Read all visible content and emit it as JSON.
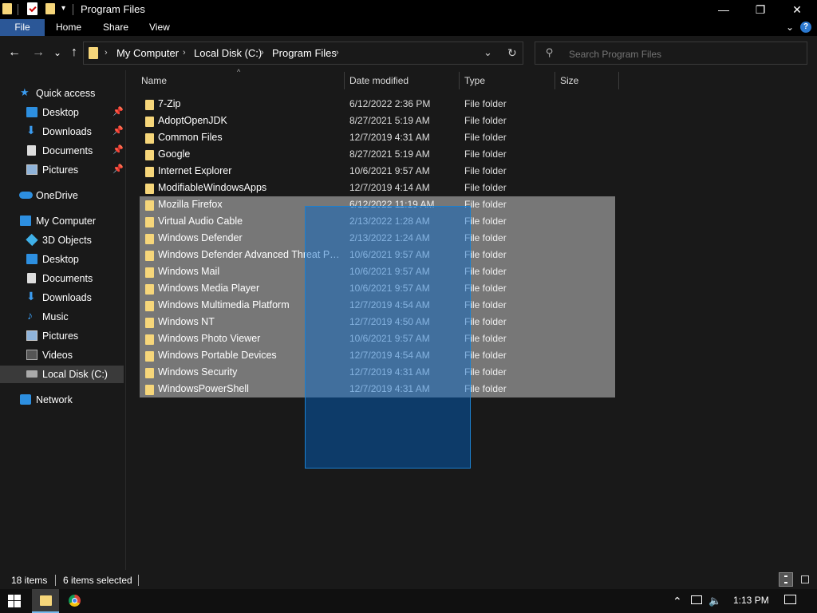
{
  "window": {
    "title": "Program Files",
    "minimize_glyph": "—",
    "maximize_glyph": "❐",
    "close_glyph": "✕"
  },
  "ribbon": {
    "tabs": [
      {
        "label": "File"
      },
      {
        "label": "Home"
      },
      {
        "label": "Share"
      },
      {
        "label": "View"
      }
    ]
  },
  "nav": {
    "back_glyph": "←",
    "forward_glyph": "→",
    "recent_glyph": "⌄",
    "up_glyph": "↑",
    "breadcrumbs": [
      "My Computer",
      "Local Disk (C:)",
      "Program Files"
    ],
    "search_placeholder": "Search Program Files"
  },
  "sidebar": {
    "items": [
      {
        "label": "Quick access",
        "icon": "star-icon"
      },
      {
        "label": "Desktop",
        "icon": "desktop-icon",
        "pinned": true
      },
      {
        "label": "Downloads",
        "icon": "download-icon",
        "pinned": true
      },
      {
        "label": "Documents",
        "icon": "document-icon",
        "pinned": true
      },
      {
        "label": "Pictures",
        "icon": "pictures-icon",
        "pinned": true
      },
      {
        "label": "OneDrive",
        "icon": "cloud-icon"
      },
      {
        "label": "My Computer",
        "icon": "computer-icon"
      },
      {
        "label": "3D Objects",
        "icon": "cube-icon"
      },
      {
        "label": "Desktop",
        "icon": "desktop-icon"
      },
      {
        "label": "Documents",
        "icon": "document-icon"
      },
      {
        "label": "Downloads",
        "icon": "download-icon"
      },
      {
        "label": "Music",
        "icon": "music-icon"
      },
      {
        "label": "Pictures",
        "icon": "pictures-icon"
      },
      {
        "label": "Videos",
        "icon": "video-icon"
      },
      {
        "label": "Local Disk (C:)",
        "icon": "drive-icon",
        "selected": true
      },
      {
        "label": "Network",
        "icon": "network-icon"
      }
    ]
  },
  "columns": {
    "name": "Name",
    "date": "Date modified",
    "type": "Type",
    "size": "Size"
  },
  "files": [
    {
      "name": "7-Zip",
      "date": "6/12/2022 2:36 PM",
      "type": "File folder",
      "selected": false
    },
    {
      "name": "AdoptOpenJDK",
      "date": "8/27/2021 5:19 AM",
      "type": "File folder",
      "selected": false
    },
    {
      "name": "Common Files",
      "date": "12/7/2019 4:31 AM",
      "type": "File folder",
      "selected": false
    },
    {
      "name": "Google",
      "date": "8/27/2021 5:19 AM",
      "type": "File folder",
      "selected": false
    },
    {
      "name": "Internet Explorer",
      "date": "10/6/2021 9:57 AM",
      "type": "File folder",
      "selected": false
    },
    {
      "name": "ModifiableWindowsApps",
      "date": "12/7/2019 4:14 AM",
      "type": "File folder",
      "selected": false
    },
    {
      "name": "Mozilla Firefox",
      "date": "6/12/2022 11:19 AM",
      "type": "File folder",
      "selected": true
    },
    {
      "name": "Virtual Audio Cable",
      "date": "2/13/2022 1:28 AM",
      "type": "File folder",
      "selected": true
    },
    {
      "name": "Windows Defender",
      "date": "2/13/2022 1:24 AM",
      "type": "File folder",
      "selected": true
    },
    {
      "name": "Windows Defender Advanced Threat Prot...",
      "date": "10/6/2021 9:57 AM",
      "type": "File folder",
      "selected": true
    },
    {
      "name": "Windows Mail",
      "date": "10/6/2021 9:57 AM",
      "type": "File folder",
      "selected": true
    },
    {
      "name": "Windows Media Player",
      "date": "10/6/2021 9:57 AM",
      "type": "File folder",
      "selected": true
    },
    {
      "name": "Windows Multimedia Platform",
      "date": "12/7/2019 4:54 AM",
      "type": "File folder",
      "selected": true
    },
    {
      "name": "Windows NT",
      "date": "12/7/2019 4:50 AM",
      "type": "File folder",
      "selected": true
    },
    {
      "name": "Windows Photo Viewer",
      "date": "10/6/2021 9:57 AM",
      "type": "File folder",
      "selected": true
    },
    {
      "name": "Windows Portable Devices",
      "date": "12/7/2019 4:54 AM",
      "type": "File folder",
      "selected": true
    },
    {
      "name": "Windows Security",
      "date": "12/7/2019 4:31 AM",
      "type": "File folder",
      "selected": true
    },
    {
      "name": "WindowsPowerShell",
      "date": "12/7/2019 4:31 AM",
      "type": "File folder",
      "selected": true
    }
  ],
  "status": {
    "item_count": "18 items",
    "selected_count": "6 items selected"
  },
  "taskbar": {
    "clock": "1:13 PM"
  },
  "colors": {
    "folder": "#f6d67a",
    "accent": "#2b5797",
    "selection": "#777777",
    "marquee": "#1b80d0"
  }
}
